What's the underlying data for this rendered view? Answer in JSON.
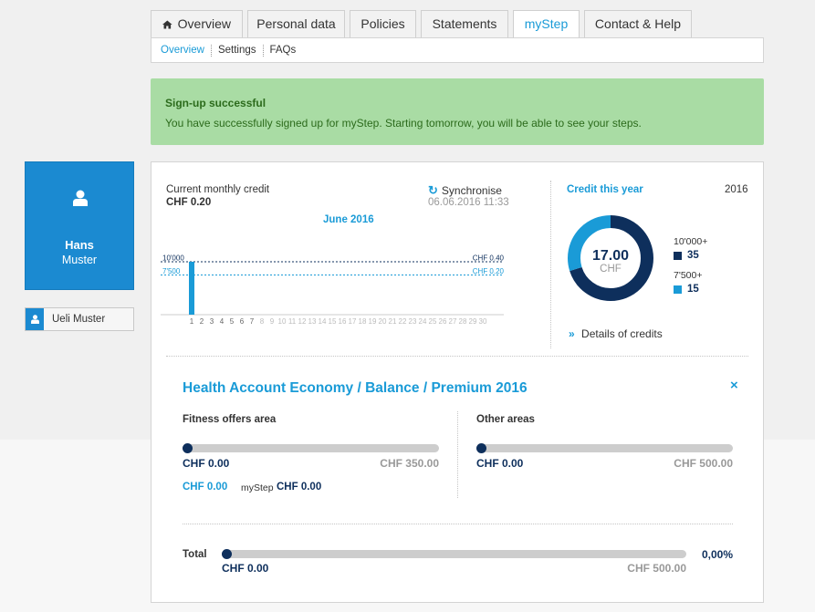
{
  "tabs": [
    {
      "label": "Overview",
      "icon": "home-icon",
      "active": false
    },
    {
      "label": "Personal data",
      "active": false
    },
    {
      "label": "Policies",
      "active": false
    },
    {
      "label": "Statements",
      "active": false
    },
    {
      "label": "myStep",
      "active": true
    },
    {
      "label": "Contact & Help",
      "active": false
    }
  ],
  "subnav": [
    {
      "label": "Overview",
      "active": true
    },
    {
      "label": "Settings",
      "active": false
    },
    {
      "label": "FAQs",
      "active": false
    }
  ],
  "banner": {
    "title": "Sign-up successful",
    "message": "You have successfully signed up for myStep. Starting tomorrow, you will be able to see your steps."
  },
  "profile": {
    "first_name": "Hans",
    "last_name": "Muster",
    "icon": "user-icon"
  },
  "member": {
    "name": "Ueli Muster",
    "icon": "user-icon"
  },
  "credit": {
    "label": "Current monthly credit",
    "value": "CHF 0.20",
    "sync_label": "Synchronise",
    "sync_time": "06.06.2016 11:33",
    "month": "June 2016"
  },
  "chart_data": {
    "type": "bar",
    "title": "June 2016",
    "categories": [
      "1",
      "2",
      "3",
      "4",
      "5",
      "6",
      "7",
      "8",
      "9",
      "10",
      "11",
      "12",
      "13",
      "14",
      "15",
      "16",
      "17",
      "18",
      "19",
      "20",
      "21",
      "22",
      "23",
      "24",
      "25",
      "26",
      "27",
      "28",
      "29",
      "30"
    ],
    "values": [
      10000,
      0,
      0,
      0,
      0,
      0,
      0,
      0,
      0,
      0,
      0,
      0,
      0,
      0,
      0,
      0,
      0,
      0,
      0,
      0,
      0,
      0,
      0,
      0,
      0,
      0,
      0,
      0,
      0,
      0
    ],
    "ylim": [
      0,
      11200
    ],
    "thresholds": [
      {
        "label": "10'000",
        "value": 10000,
        "reward": "CHF 0.40",
        "color": "#0e2f5c"
      },
      {
        "label": "7'500",
        "value": 7500,
        "reward": "CHF 0.20",
        "color": "#1a9bd7"
      }
    ],
    "bar_color": "#1a9bd7",
    "active_days": 7
  },
  "year": {
    "title": "Credit this year",
    "year": "2016",
    "total": "17.00",
    "currency": "CHF",
    "legend": [
      {
        "label": "10'000+",
        "value": "35",
        "color": "#0e2f5c",
        "share": 0.7
      },
      {
        "label": "7'500+",
        "value": "15",
        "color": "#1a9bd7",
        "share": 0.3
      }
    ],
    "details_link": "Details of credits"
  },
  "health": {
    "title": "Health Account Economy / Balance / Premium 2016",
    "fitness": {
      "title": "Fitness offers area",
      "current": "CHF 0.00",
      "max": "CHF 350.00",
      "progress": 0,
      "sub_value": "CHF 0.00",
      "sub_label": "myStep",
      "sub_value2": "CHF 0.00"
    },
    "other": {
      "title": "Other areas",
      "current": "CHF 0.00",
      "max": "CHF 500.00",
      "progress": 0
    },
    "total": {
      "label": "Total",
      "current": "CHF 0.00",
      "max": "CHF 500.00",
      "percent": "0,00%",
      "progress": 0
    }
  }
}
